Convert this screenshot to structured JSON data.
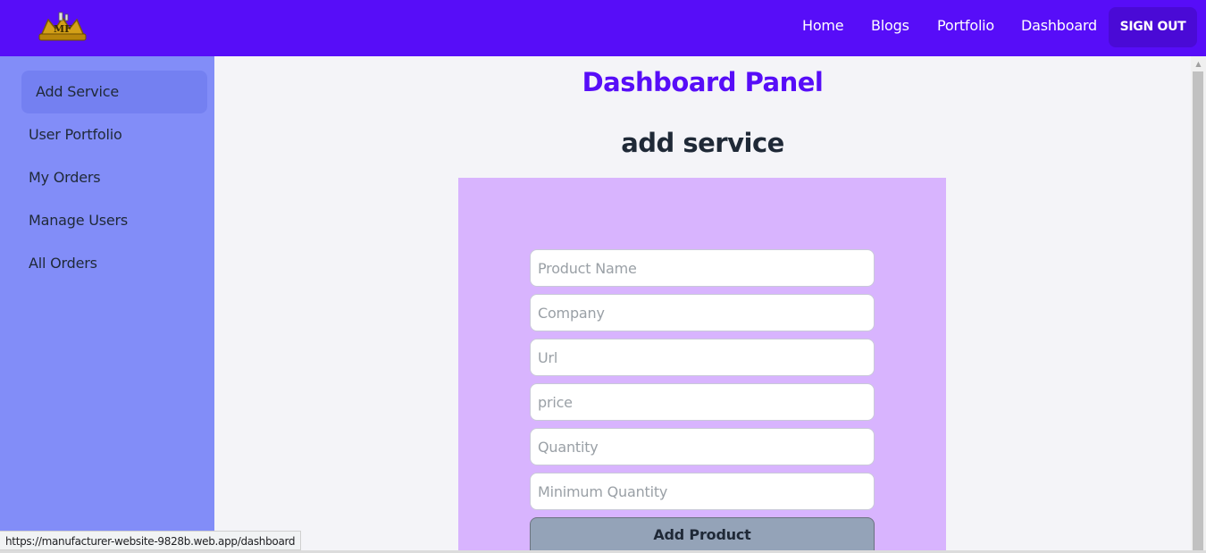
{
  "header": {
    "logo_text": "MF",
    "nav": [
      "Home",
      "Blogs",
      "Portfolio",
      "Dashboard"
    ],
    "signout_label": "SIGN OUT"
  },
  "sidebar": {
    "items": [
      {
        "label": "Add Service",
        "active": true
      },
      {
        "label": "User Portfolio"
      },
      {
        "label": "My Orders"
      },
      {
        "label": "Manage Users"
      },
      {
        "label": "All Orders"
      }
    ]
  },
  "main": {
    "title": "Dashboard Panel",
    "subtitle": "add service",
    "form": {
      "product_name_placeholder": "Product Name",
      "company_placeholder": "Company",
      "url_placeholder": "Url",
      "price_placeholder": "price",
      "quantity_placeholder": "Quantity",
      "min_quantity_placeholder": "Minimum Quantity",
      "submit_label": "Add Product"
    }
  },
  "status_bar": {
    "url": "https://manufacturer-website-9828b.web.app/dashboard"
  },
  "colors": {
    "primary": "#570df8",
    "sidebar": "#828df8",
    "form_panel": "#d8b4fe",
    "submit": "#94a3b8"
  }
}
